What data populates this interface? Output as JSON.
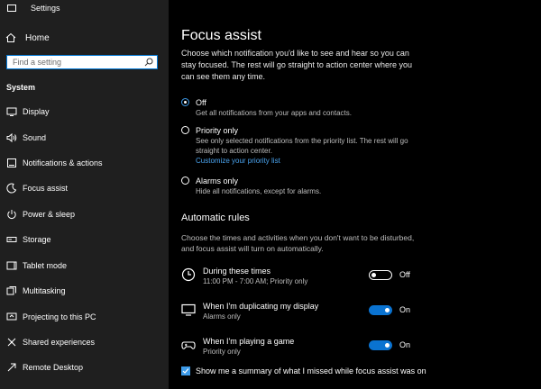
{
  "window": {
    "title": "Settings"
  },
  "sidebar": {
    "home_label": "Home",
    "search_placeholder": "Find a setting",
    "section": "System",
    "items": [
      {
        "label": "Display",
        "icon": "display-icon"
      },
      {
        "label": "Sound",
        "icon": "sound-icon"
      },
      {
        "label": "Notifications & actions",
        "icon": "notifications-icon"
      },
      {
        "label": "Focus assist",
        "icon": "focus-assist-icon",
        "selected": true
      },
      {
        "label": "Power & sleep",
        "icon": "power-icon"
      },
      {
        "label": "Storage",
        "icon": "storage-icon"
      },
      {
        "label": "Tablet mode",
        "icon": "tablet-icon"
      },
      {
        "label": "Multitasking",
        "icon": "multitasking-icon"
      },
      {
        "label": "Projecting to this PC",
        "icon": "projecting-icon"
      },
      {
        "label": "Shared experiences",
        "icon": "shared-experiences-icon"
      },
      {
        "label": "Remote Desktop",
        "icon": "remote-desktop-icon"
      }
    ]
  },
  "main": {
    "title": "Focus assist",
    "description": "Choose which notification you'd like to see and hear so you can stay focused. The rest will go straight to action center where you can see them any time.",
    "options": [
      {
        "label": "Off",
        "desc": "Get all notifications from your apps and contacts.",
        "checked": true
      },
      {
        "label": "Priority only",
        "desc": "See only selected notifications from the priority list. The rest will go straight to action center.",
        "link": "Customize your priority list",
        "checked": false
      },
      {
        "label": "Alarms only",
        "desc": "Hide all notifications, except for alarms.",
        "checked": false
      }
    ],
    "automatic_rules": {
      "title": "Automatic rules",
      "description": "Choose the times and activities when you don't want to be disturbed, and focus assist will turn on automatically.",
      "rules": [
        {
          "name": "During these times",
          "sub": "11:00 PM - 7:00 AM; Priority only",
          "state": "Off",
          "on": false,
          "icon": "clock-icon"
        },
        {
          "name": "When I'm duplicating my display",
          "sub": "Alarms only",
          "state": "On",
          "on": true,
          "icon": "monitor-icon"
        },
        {
          "name": "When I'm playing a game",
          "sub": "Priority only",
          "state": "On",
          "on": true,
          "icon": "gamepad-icon"
        }
      ]
    },
    "summary_checkbox": {
      "label": "Show me a summary of what I missed while focus assist was on",
      "checked": true
    }
  },
  "colors": {
    "accent": "#0a73d1",
    "link": "#4aa3ee",
    "sidebar_bg": "#1f1f1f"
  }
}
